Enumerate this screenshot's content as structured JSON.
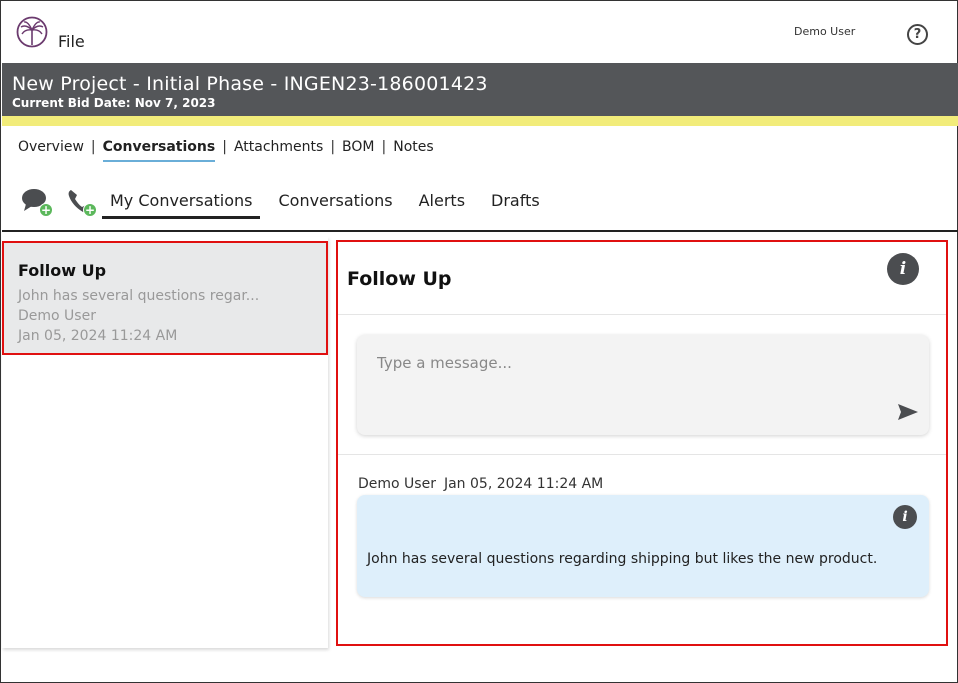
{
  "app": {
    "file_menu": "File",
    "user_name": "Demo User",
    "help_symbol": "?"
  },
  "project": {
    "title": "New Project - Initial Phase - INGEN23-186001423",
    "bid_date": "Current Bid Date: Nov 7, 2023"
  },
  "section_nav": {
    "items": [
      {
        "label": "Overview"
      },
      {
        "label": "Conversations",
        "active": true
      },
      {
        "label": "Attachments"
      },
      {
        "label": "BOM"
      },
      {
        "label": "Notes"
      }
    ],
    "separator": "|"
  },
  "conversation_tabs": {
    "tabs": [
      {
        "label": "My Conversations",
        "active": true
      },
      {
        "label": "Conversations"
      },
      {
        "label": "Alerts"
      },
      {
        "label": "Drafts"
      }
    ]
  },
  "conversation_list": {
    "items": [
      {
        "title": "Follow Up",
        "preview": "John has several questions regar...",
        "author": "Demo User",
        "date": "Jan 05, 2024 11:24 AM",
        "selected": true
      }
    ]
  },
  "detail": {
    "title": "Follow Up",
    "compose_placeholder": "Type a message...",
    "messages": [
      {
        "author": "Demo User",
        "date": "Jan 05, 2024 11:24 AM",
        "text": "John has several questions regarding shipping but likes the new product."
      }
    ]
  },
  "icons": {
    "logo": "palm-tree-logo-icon",
    "help": "help-circle-icon",
    "new_chat": "chat-bubbles-add-icon",
    "new_call": "phone-add-icon",
    "info": "info-icon",
    "send": "send-icon",
    "info_glyph": "i",
    "plus_glyph": "+"
  },
  "colors": {
    "header_bg": "#545659",
    "accent_strip": "#f2ec7a",
    "highlight_border": "#e01010",
    "message_bubble": "#deeffb",
    "active_tab_underline": "#6aaed8"
  }
}
